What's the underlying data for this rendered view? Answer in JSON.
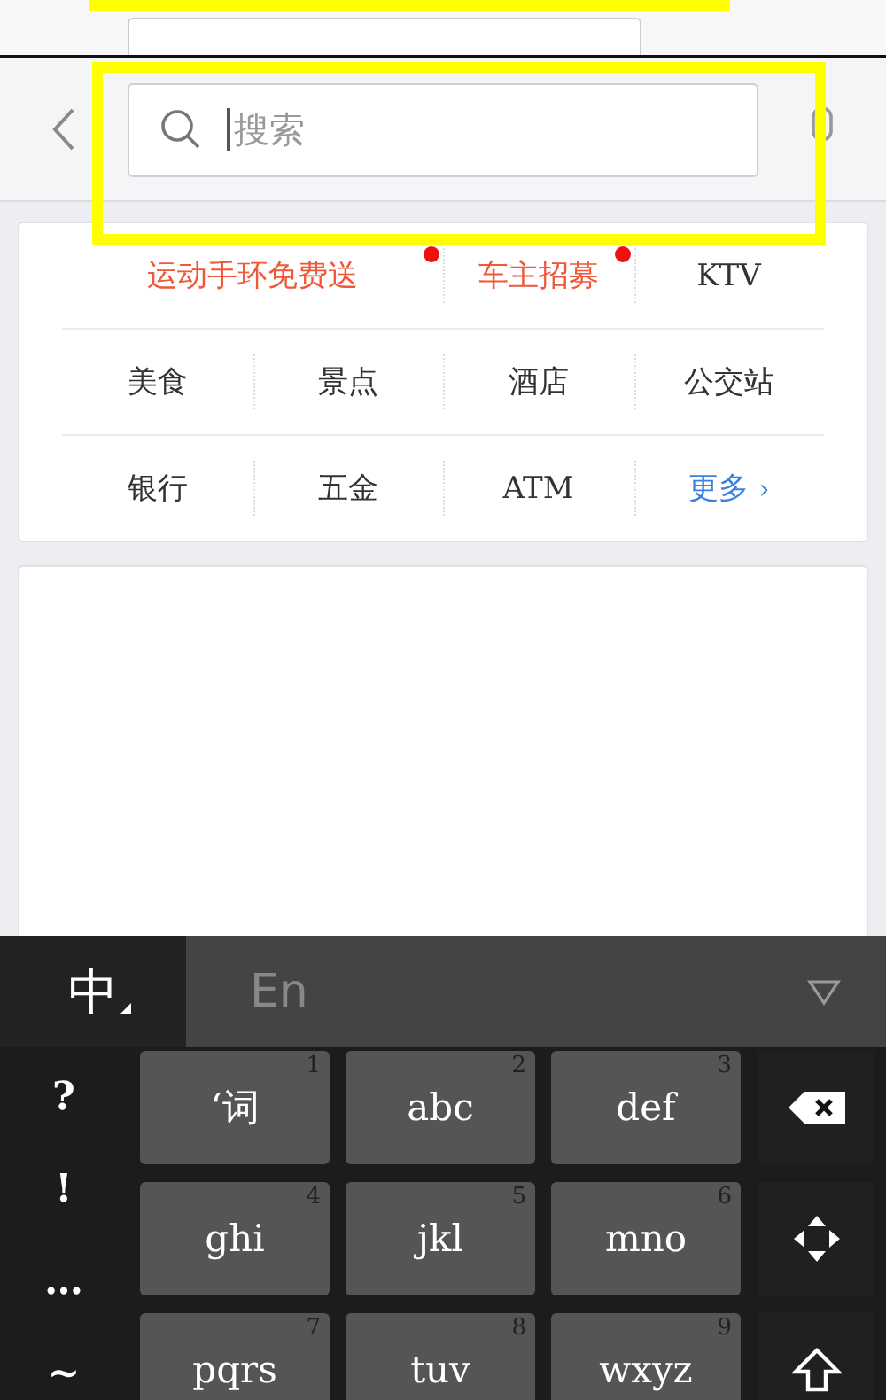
{
  "header": {
    "search": {
      "placeholder": "搜索"
    }
  },
  "shortcut_rows": [
    [
      {
        "label": "运动手环免费送",
        "kind": "promo",
        "dot": true
      },
      {
        "label": "车主招募",
        "kind": "promo",
        "dot": true
      },
      {
        "label": "KTV",
        "kind": "plain",
        "dot": false
      }
    ],
    [
      {
        "label": "美食",
        "kind": "plain",
        "dot": false
      },
      {
        "label": "景点",
        "kind": "plain",
        "dot": false
      },
      {
        "label": "酒店",
        "kind": "plain",
        "dot": false
      },
      {
        "label": "公交站",
        "kind": "plain",
        "dot": false
      }
    ],
    [
      {
        "label": "银行",
        "kind": "plain",
        "dot": false
      },
      {
        "label": "五金",
        "kind": "plain",
        "dot": false
      },
      {
        "label": "ATM",
        "kind": "plain",
        "dot": false
      },
      {
        "label": "更多",
        "kind": "more",
        "dot": false,
        "arrow": "›"
      }
    ]
  ],
  "keyboard": {
    "modes": [
      {
        "label": "中",
        "selected": true
      },
      {
        "label": "En",
        "selected": false
      }
    ],
    "symbols": [
      "?",
      "!",
      "…",
      "~"
    ],
    "keys": [
      {
        "label": "‘词",
        "digit": "1"
      },
      {
        "label": "abc",
        "digit": "2"
      },
      {
        "label": "def",
        "digit": "3"
      },
      {
        "label": "ghi",
        "digit": "4"
      },
      {
        "label": "jkl",
        "digit": "5"
      },
      {
        "label": "mno",
        "digit": "6"
      },
      {
        "label": "pqrs",
        "digit": "7"
      },
      {
        "label": "tuv",
        "digit": "8"
      },
      {
        "label": "wxyz",
        "digit": "9"
      }
    ],
    "side_keys": [
      {
        "kind": "backspace"
      },
      {
        "kind": "cursor"
      },
      {
        "kind": "shift"
      }
    ]
  }
}
